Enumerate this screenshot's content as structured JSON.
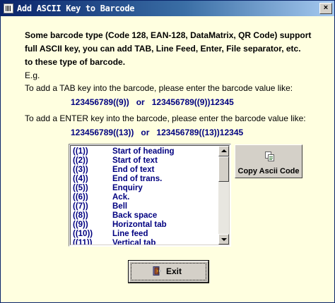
{
  "window": {
    "title": "Add ASCII Key to Barcode",
    "close_label": "×"
  },
  "intro": {
    "line1": "Some barcode type (Code 128, EAN-128, DataMatrix, QR Code) support",
    "line2": "full ASCII key, you can add TAB, Line Feed, Enter, File separator, etc.",
    "line3": "to these type of barcode.",
    "eg": "E.g."
  },
  "tab_example": {
    "description": "To add a TAB key into the barcode, please enter the barcode value like:",
    "example": "123456789((9))   or   123456789((9))12345"
  },
  "enter_example": {
    "description": "To add a ENTER key into the barcode, please enter the barcode value like:",
    "example": "123456789((13))   or   123456789((13))12345"
  },
  "ascii_list": [
    {
      "code": "((1))",
      "name": "Start of heading"
    },
    {
      "code": "((2))",
      "name": "Start of text"
    },
    {
      "code": "((3))",
      "name": "End of text"
    },
    {
      "code": "((4))",
      "name": "End of trans."
    },
    {
      "code": "((5))",
      "name": "Enquiry"
    },
    {
      "code": "((6))",
      "name": "Ack."
    },
    {
      "code": "((7))",
      "name": "Bell"
    },
    {
      "code": "((8))",
      "name": "Back space"
    },
    {
      "code": "((9))",
      "name": "Horizontal tab"
    },
    {
      "code": "((10))",
      "name": "Line feed"
    },
    {
      "code": "((11))",
      "name": "Vertical tab"
    }
  ],
  "buttons": {
    "copy_label": "Copy Ascii Code",
    "exit_label": "Exit"
  },
  "icons": {
    "title": "barcode-app-icon",
    "copy": "copy-document-icon",
    "exit": "exit-door-icon"
  },
  "colors": {
    "background": "#ffffe0",
    "example_text": "#000080",
    "titlebar": "#0a246a"
  }
}
